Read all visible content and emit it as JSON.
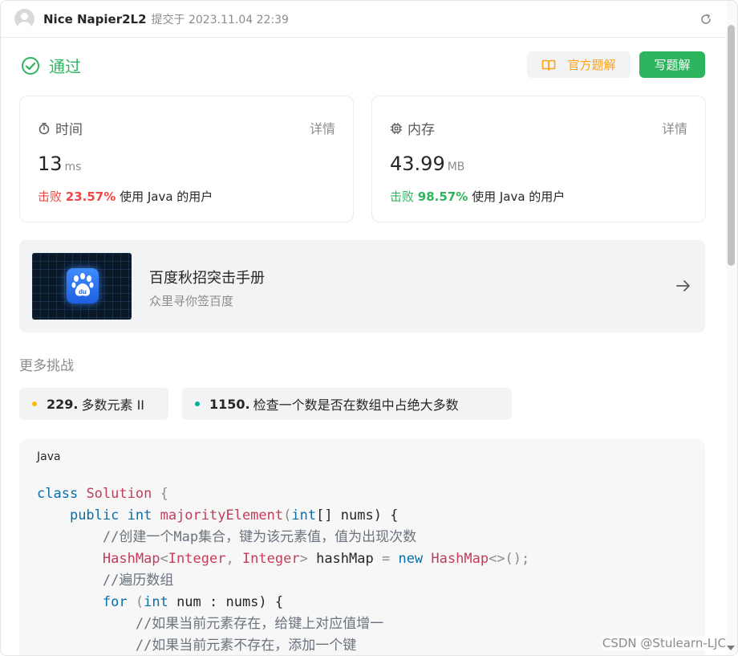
{
  "header": {
    "username": "Nice Napier2L2",
    "submitted_text": "提交于 2023.11.04 22:39"
  },
  "status": {
    "label": "通过",
    "color": "#2db55d"
  },
  "actions": {
    "official_solution": "官方题解",
    "write_solution": "写题解"
  },
  "runtime": {
    "title": "时间",
    "detail": "详情",
    "value": "13",
    "unit": "ms",
    "beat_label": "击败",
    "beat_pct": "23.57%",
    "suffix": "使用 Java 的用户"
  },
  "memory": {
    "title": "内存",
    "detail": "详情",
    "value": "43.99",
    "unit": "MB",
    "beat_label": "击败",
    "beat_pct": "98.57%",
    "suffix": "使用 Java 的用户"
  },
  "promo": {
    "logo_text": "du",
    "title": "百度秋招突击手册",
    "subtitle": "众里寻你签百度"
  },
  "more": {
    "title": "更多挑战",
    "items": [
      {
        "num": "229.",
        "title": "多数元素 II",
        "dot_color": "#ffb800"
      },
      {
        "num": "1150.",
        "title": "检查一个数是否在数组中占绝大多数",
        "dot_color": "#00af9b"
      }
    ]
  },
  "code": {
    "language": "Java",
    "lines": {
      "l1_kw": "class",
      "l1_cls": "Solution",
      "l1_rest": " {",
      "l2_kw1": "public",
      "l2_kw2": "int",
      "l2_fn": "majorityElement",
      "l2_kw3": "int",
      "l2_rest": "[] nums) {",
      "l3": "//创建一个Map集合，键为该元素值，值为出现次数",
      "l4_cls1": "HashMap",
      "l4_cls2": "Integer",
      "l4_cls3": "Integer",
      "l4_var": " hashMap ",
      "l4_kw": "new",
      "l4_cls4": "HashMap",
      "l4_rest": "<>();",
      "l5": "//遍历数组",
      "l6_kw1": "for",
      "l6_kw2": "int",
      "l6_rest": " num : nums) {",
      "l7": "//如果当前元素存在，给键上对应值增一",
      "l8": "//如果当前元素不存在，添加一个键"
    }
  },
  "watermark": "CSDN @Stulearn-LJC"
}
